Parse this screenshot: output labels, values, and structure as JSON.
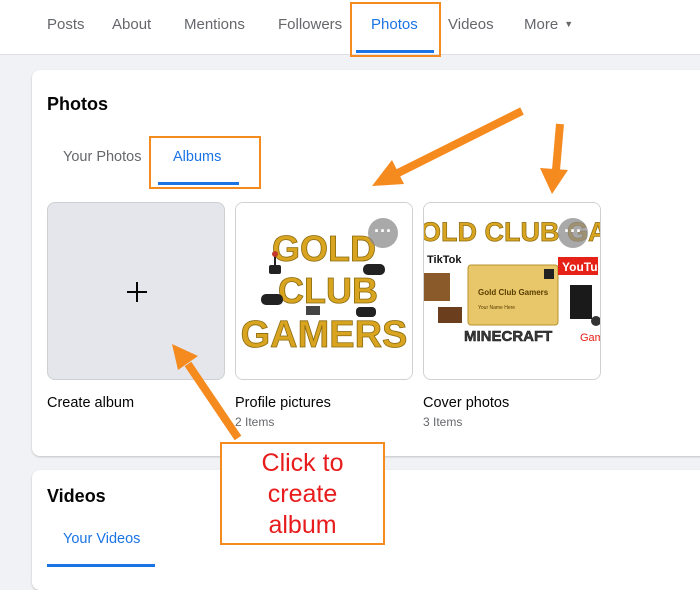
{
  "nav": {
    "tabs": [
      {
        "label": "Posts"
      },
      {
        "label": "About"
      },
      {
        "label": "Mentions"
      },
      {
        "label": "Followers"
      },
      {
        "label": "Photos",
        "active": true
      },
      {
        "label": "Videos"
      },
      {
        "label": "More"
      }
    ]
  },
  "photos": {
    "title": "Photos",
    "tabs": [
      {
        "label": "Your Photos"
      },
      {
        "label": "Albums",
        "active": true
      }
    ],
    "albums": [
      {
        "name": "Create album",
        "count": ""
      },
      {
        "name": "Profile pictures",
        "count": "2 Items"
      },
      {
        "name": "Cover photos",
        "count": "3 Items"
      }
    ]
  },
  "profile_art": {
    "line1": "GOLD",
    "line2": "CLUB",
    "line3": "GAMERS"
  },
  "cover_art": {
    "headline": "OLD CLUB GAMI",
    "tiktok": "TikTok",
    "card_title": "Gold Club Gamers",
    "card_name": "Your Name Here",
    "minecraft": "MINECRAFT",
    "youtube": "YouTu",
    "gam": "Gam"
  },
  "videos": {
    "title": "Videos",
    "tabs": [
      {
        "label": "Your Videos",
        "active": true
      }
    ]
  },
  "annotation": {
    "callout_line1": "Click to",
    "callout_line2": "create",
    "callout_line3": "album"
  },
  "colors": {
    "accent": "#1b74e4",
    "highlight": "#f58a1f",
    "callout_text": "#e81c1c",
    "gold": "#d9a520"
  }
}
